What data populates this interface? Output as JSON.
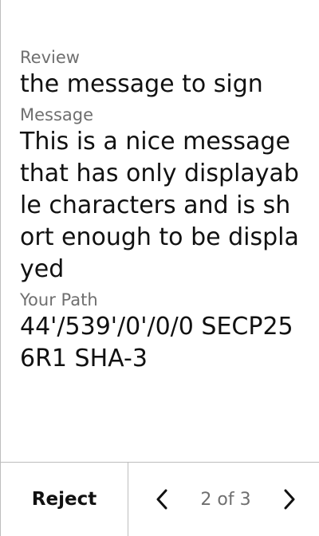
{
  "review": {
    "label": "Review",
    "value": "the message to sign"
  },
  "message": {
    "label": "Message",
    "value": "This is a nice message that has only displayable characters and is short enough to be displayed"
  },
  "path": {
    "label": "Your Path",
    "value": "44'/539'/0'/0/0   SECP256R1 SHA-3"
  },
  "footer": {
    "reject_label": "Reject",
    "prev_icon": "chevron-left-icon",
    "next_icon": "chevron-right-icon",
    "page_indicator": "2 of 3"
  }
}
